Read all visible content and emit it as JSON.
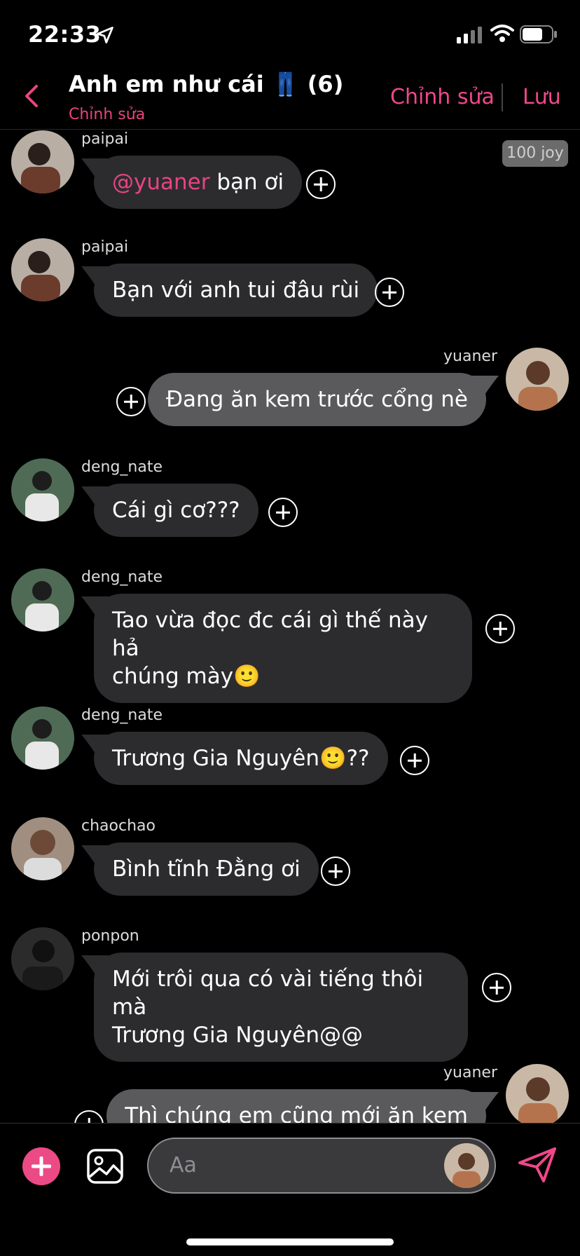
{
  "status_bar": {
    "time": "22:33"
  },
  "header": {
    "title": "Anh em như cái 👖 (6)",
    "subtitle": "Chỉnh sửa",
    "edit_label": "Chỉnh sửa",
    "save_label": "Lưu"
  },
  "badge": {
    "joy": "100 joy"
  },
  "messages": [
    {
      "user": "paipai",
      "text_mention": "@yuaner",
      "text": " bạn ơi",
      "side": "left"
    },
    {
      "user": "paipai",
      "text": "Bạn với anh tui đâu rùi",
      "side": "left"
    },
    {
      "user": "yuaner",
      "text": "Đang ăn kem trước cổng nè",
      "side": "right"
    },
    {
      "user": "deng_nate",
      "text": "Cái gì cơ???",
      "side": "left"
    },
    {
      "user": "deng_nate",
      "text_line1": "Tao vừa đọc đc cái gì thế này hả",
      "text_line2": "chúng mày🙂",
      "side": "left"
    },
    {
      "user": "deng_nate",
      "text": "Trương Gia Nguyên🙂??",
      "side": "left"
    },
    {
      "user": "chaochao",
      "text": "Bình tĩnh Đằng ơi",
      "side": "left"
    },
    {
      "user": "ponpon",
      "text_line1": "Mới trôi qua có vài tiếng thôi mà",
      "text_line2": "Trương Gia Nguyên@@",
      "side": "left"
    },
    {
      "user": "yuaner",
      "text": "Thì chúng em cũng mới ăn kem",
      "side": "right"
    }
  ],
  "composer": {
    "placeholder": "Aa"
  },
  "colors": {
    "accent": "#f0478a",
    "bubble_left": "#2c2c2e",
    "bubble_right": "#5a5a5c",
    "background": "#000000"
  },
  "icons": [
    "location-arrow-icon",
    "signal-icon",
    "wifi-icon",
    "battery-icon",
    "back-chevron-icon",
    "plus-circle-icon",
    "add-icon",
    "image-icon",
    "send-icon"
  ]
}
